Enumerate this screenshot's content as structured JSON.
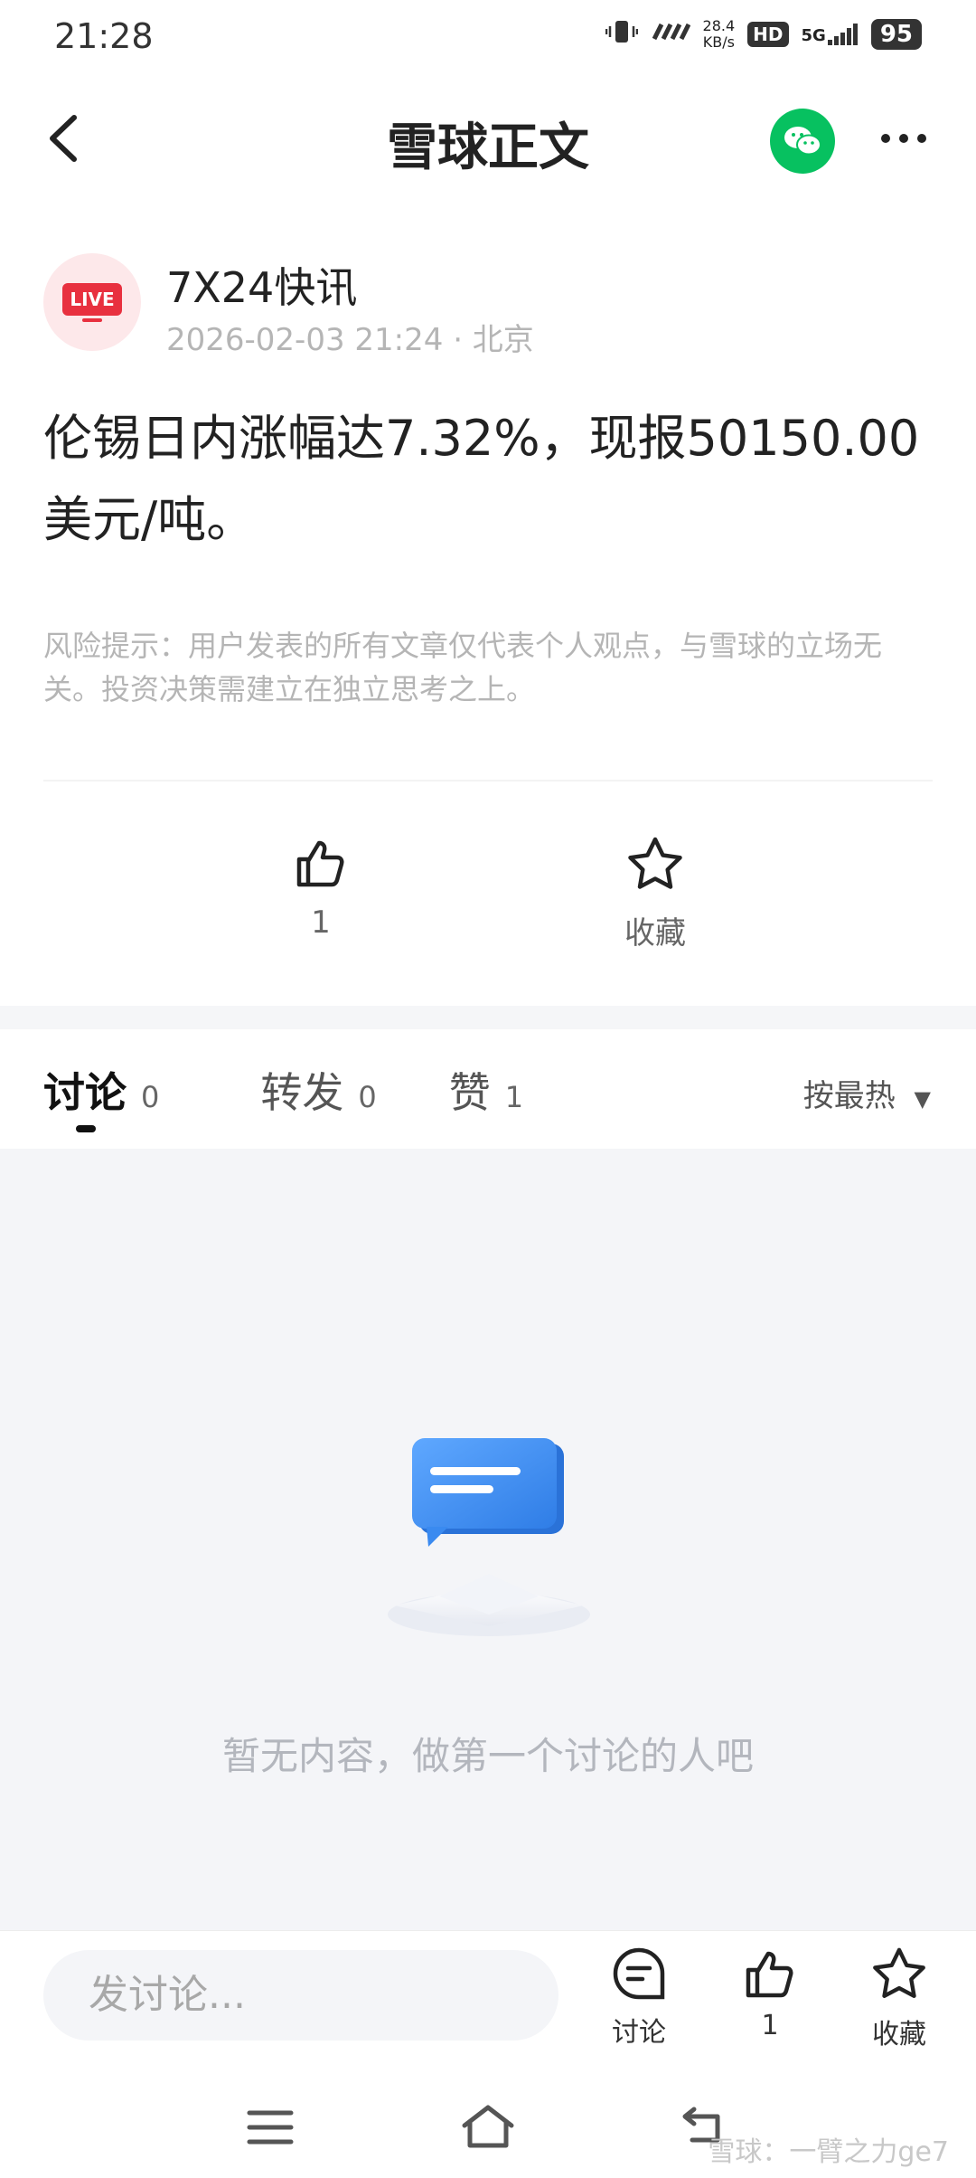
{
  "status_bar": {
    "time": "21:28",
    "speed_value": "28.4",
    "speed_unit": "KB/s",
    "hd": "HD",
    "network": "5G",
    "battery": "95"
  },
  "header": {
    "title": "雪球正文",
    "back_icon": "chevron-left-icon",
    "share_icon": "wechat-icon",
    "more_icon": "more-horizontal-icon"
  },
  "post": {
    "author": "7X24快讯",
    "avatar_badge": "LIVE",
    "meta": "2026-02-03 21:24 · 北京",
    "content": "伦锡日内涨幅达7.32%，现报50150.00美元/吨。",
    "risk_notice": "风险提示：用户发表的所有文章仅代表个人观点，与雪球的立场无关。投资决策需建立在独立思考之上。"
  },
  "actions": {
    "like_count": "1",
    "favorite_label": "收藏"
  },
  "tabs": [
    {
      "label": "讨论",
      "count": "0",
      "active": true
    },
    {
      "label": "转发",
      "count": "0",
      "active": false
    },
    {
      "label": "赞",
      "count": "1",
      "active": false
    }
  ],
  "sort": {
    "label": "按最热",
    "arrow": "▼"
  },
  "empty_state": {
    "text": "暂无内容，做第一个讨论的人吧"
  },
  "bottom_bar": {
    "input_placeholder": "发讨论...",
    "discuss_label": "讨论",
    "like_count": "1",
    "favorite_label": "收藏"
  },
  "watermark": "雪球：一臂之力ge7",
  "colors": {
    "accent_green": "#07c160",
    "live_red": "#e8303f",
    "empty_bg": "#f4f5f8",
    "chat_blue": "#3d8ef0"
  }
}
